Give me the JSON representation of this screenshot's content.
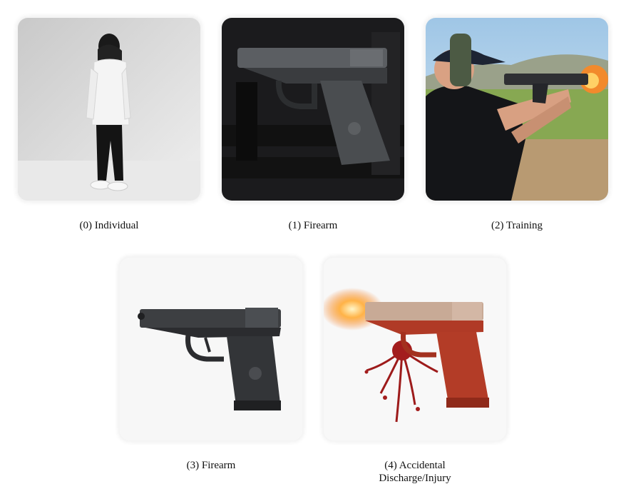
{
  "panels": [
    {
      "index": 0,
      "caption": "(0) Individual",
      "icon": "person-photo"
    },
    {
      "index": 1,
      "caption": "(1) Firearm",
      "icon": "pistol-on-vest-photo"
    },
    {
      "index": 2,
      "caption": "(2) Training",
      "icon": "shooter-range-photo"
    },
    {
      "index": 3,
      "caption": "(3) Firearm",
      "icon": "pistol-photo"
    },
    {
      "index": 4,
      "caption_line1": "(4) Accidental",
      "caption_line2": "Discharge/Injury",
      "icon": "pistol-discharge-photo"
    }
  ]
}
